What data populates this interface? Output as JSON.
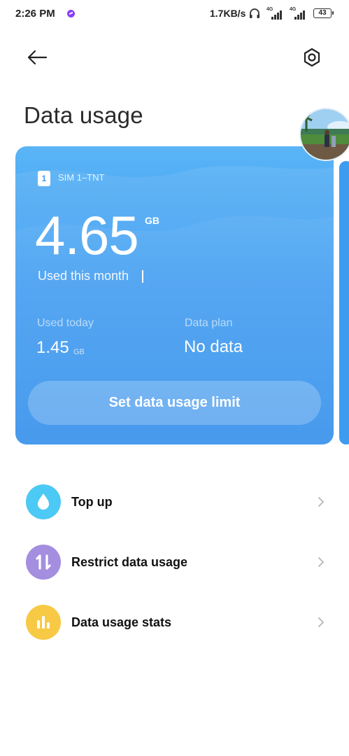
{
  "status_bar": {
    "time": "2:26 PM",
    "net_speed": "1.7KB/s",
    "signal_tag_1": "4G",
    "signal_tag_2": "4G",
    "battery": "43",
    "icons": [
      "messenger-icon",
      "headset-icon",
      "signal-icon",
      "signal-icon",
      "battery-icon"
    ]
  },
  "header": {
    "title": "Data usage",
    "back_icon": "arrow-left-icon",
    "settings_icon": "gear-icon"
  },
  "card": {
    "sim_number": "1",
    "sim_label": "SIM 1–TNT",
    "used_value": "4.65",
    "used_unit": "GB",
    "used_label": "Used this month",
    "today_label": "Used today",
    "today_value": "1.45",
    "today_unit": "GB",
    "plan_label": "Data plan",
    "plan_value": "No data",
    "limit_button": "Set data usage limit",
    "color": "#3e9cf1"
  },
  "list": [
    {
      "label": "Top up",
      "icon": "water-drop-icon",
      "color": "#4cc9f4"
    },
    {
      "label": "Restrict data usage",
      "icon": "arrows-up-down-icon",
      "color": "#a48ee0"
    },
    {
      "label": "Data usage stats",
      "icon": "bar-chart-icon",
      "color": "#f7c945"
    }
  ]
}
